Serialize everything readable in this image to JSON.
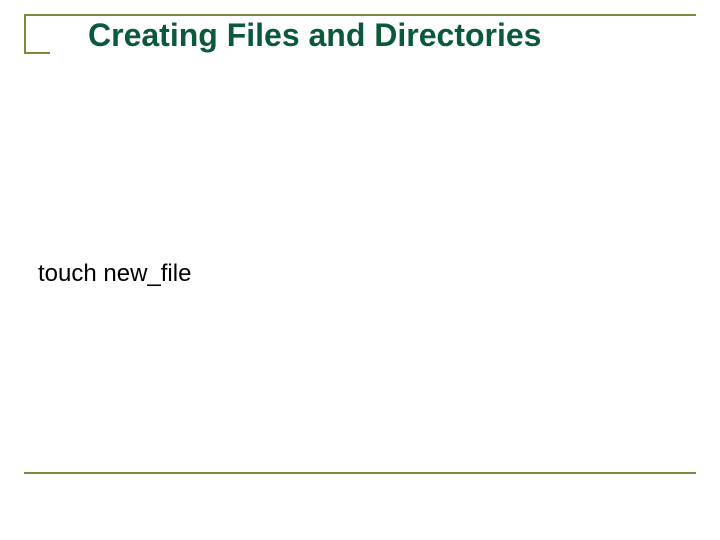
{
  "slide": {
    "title": "Creating Files and Directories",
    "body_line": "touch new_file"
  }
}
